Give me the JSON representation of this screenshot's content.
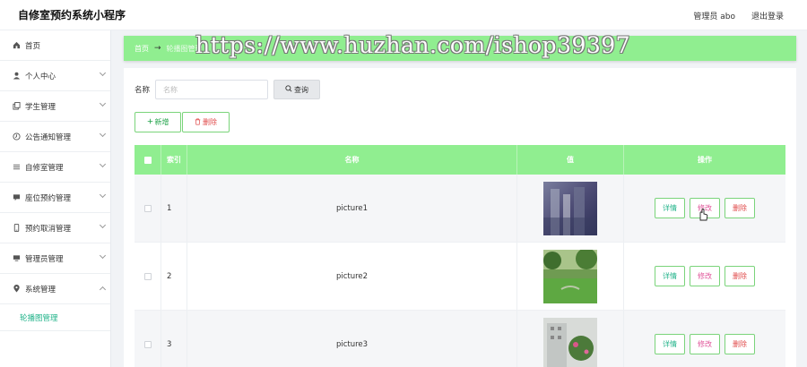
{
  "app": {
    "title": "自修室预约系统小程序"
  },
  "header": {
    "admin_label": "管理员 abo",
    "logout_label": "退出登录"
  },
  "sidebar": {
    "items": [
      {
        "label": "首页",
        "icon": "home-icon"
      },
      {
        "label": "个人中心",
        "icon": "user-icon"
      },
      {
        "label": "学生管理",
        "icon": "copy-icon"
      },
      {
        "label": "公告通知管理",
        "icon": "clock-icon"
      },
      {
        "label": "自修室管理",
        "icon": "list-icon"
      },
      {
        "label": "座位预约管理",
        "icon": "chat-icon"
      },
      {
        "label": "预约取消管理",
        "icon": "phone-icon"
      },
      {
        "label": "管理员管理",
        "icon": "monitor-icon"
      },
      {
        "label": "系统管理",
        "icon": "location-icon"
      }
    ],
    "subitem": {
      "label": "轮播图管理"
    }
  },
  "breadcrumb": {
    "home": "首页",
    "arrow": "→",
    "current": "轮播图管理"
  },
  "watermark": "https://www.huzhan.com/ishop39397",
  "search": {
    "label": "名称",
    "placeholder": "名称",
    "button": "查询"
  },
  "actions": {
    "add": "新增",
    "delete": "删除"
  },
  "table": {
    "headers": {
      "index": "索引",
      "name": "名称",
      "value": "值",
      "operation": "操作"
    },
    "rows": [
      {
        "index": "1",
        "name": "picture1"
      },
      {
        "index": "2",
        "name": "picture2"
      },
      {
        "index": "3",
        "name": "picture3"
      }
    ],
    "row_actions": {
      "detail": "详情",
      "edit": "修改",
      "delete": "删除"
    }
  },
  "colors": {
    "accent": "#90ee90",
    "active_text": "#22b38a",
    "danger": "#e04b4b"
  }
}
